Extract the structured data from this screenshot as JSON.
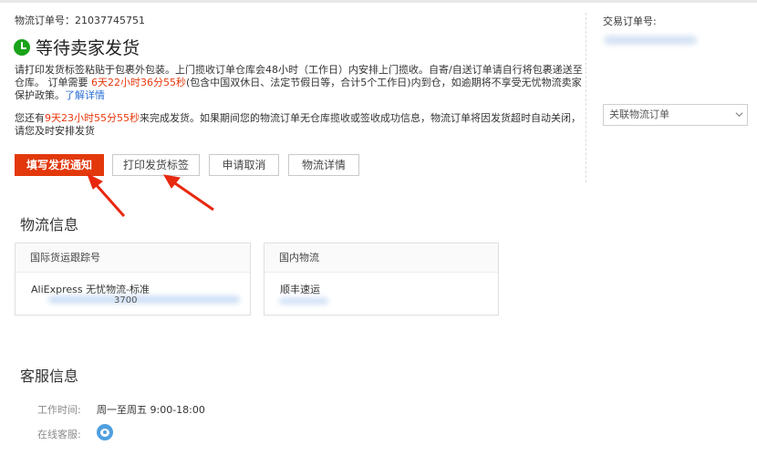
{
  "order": {
    "logistics_order_label": "物流订单号：",
    "logistics_order_no": "21037745751",
    "status": "等待卖家发货"
  },
  "notice": {
    "p1_a": "请打印发货标签粘贴于包裹外包装。上门揽收订单仓库会48小时（工作日）内安排上门揽收。自寄/自送订单请自行将包裹递送至仓库。 订单需要 ",
    "p1_countdown": "6天22小时36分55秒",
    "p1_b": "(包含中国双休日、法定节假日等，合计5个工作日)内到仓，如逾期将不享受无忧物流卖家保护政策。",
    "p1_link": "了解详情",
    "p2_a": "您还有",
    "p2_countdown": "9天23小时55分55秒",
    "p2_b": "来完成发货。如果期间您的物流订单无仓库揽收或签收成功信息，物流订单将因发货超时自动关闭，请您及时安排发货"
  },
  "actions": {
    "fill_notice": "填写发货通知",
    "print_label": "打印发货标签",
    "cancel": "申请取消",
    "logistics_detail": "物流详情"
  },
  "logistics": {
    "title": "物流信息",
    "intl_header": "国际货运跟踪号",
    "intl_value": "AliExpress 无忧物流-标准",
    "intl_tracking_visible": "3700",
    "domestic_header": "国内物流",
    "domestic_value": "顺丰速运"
  },
  "service": {
    "title": "客服信息",
    "hours_label": "工作时间:",
    "hours_value": "周一至周五 9:00-18:00",
    "online_label": "在线客服:"
  },
  "sidebar": {
    "trade_order_label": "交易订单号:",
    "related_select": "关联物流订单"
  },
  "colors": {
    "accent_red": "#e2380c",
    "link_blue": "#2a6fd6",
    "status_green": "#1aa31a",
    "annotation_arrow": "#e8280f"
  }
}
